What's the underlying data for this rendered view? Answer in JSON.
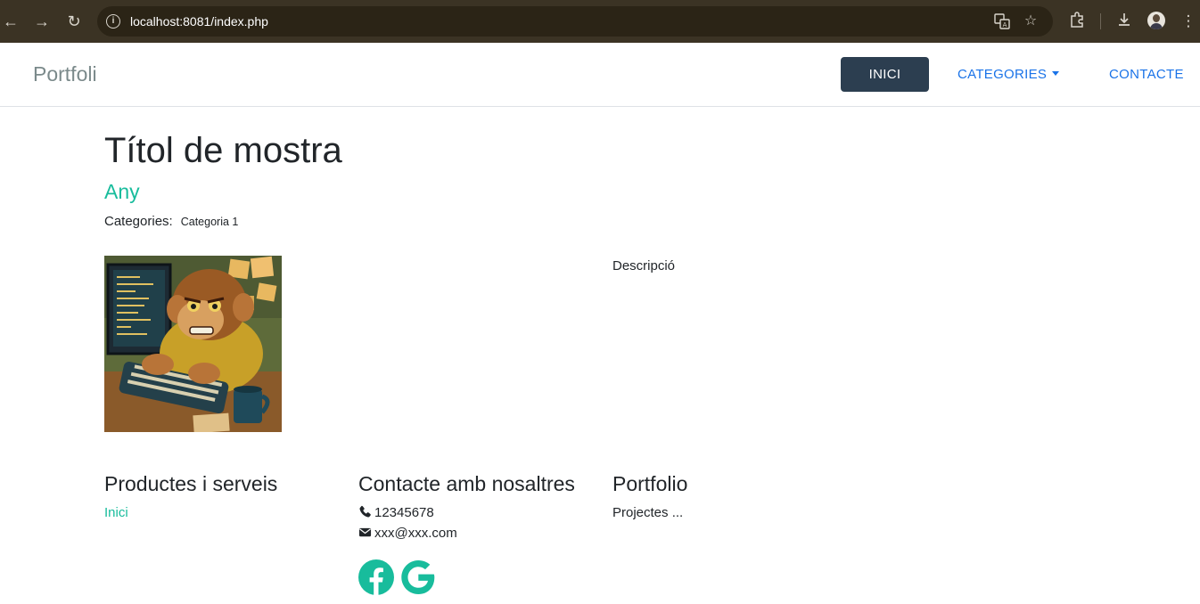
{
  "browser": {
    "url_host": "localhost:8081/",
    "url_path": "index.php"
  },
  "navbar": {
    "brand": "Portfoli",
    "items": [
      {
        "label": "INICI"
      },
      {
        "label": "CATEGORIES"
      },
      {
        "label": "CONTACTE"
      }
    ]
  },
  "project": {
    "title": "Títol de mostra",
    "year": "Any",
    "categories_label": "Categories:",
    "category": "Categoria 1",
    "description": "Descripció",
    "image_icon": "monkey-coder-illustration"
  },
  "footer": {
    "products": {
      "title": "Productes i serveis",
      "link": "Inici"
    },
    "contact": {
      "title": "Contacte amb nosaltres",
      "phone": "12345678",
      "email": "xxx@xxx.com"
    },
    "portfolio": {
      "title": "Portfolio",
      "text": "Projectes ..."
    }
  },
  "colors": {
    "primary": "#2c3e50",
    "accent": "#18bc9c",
    "link": "#1a73e8"
  }
}
